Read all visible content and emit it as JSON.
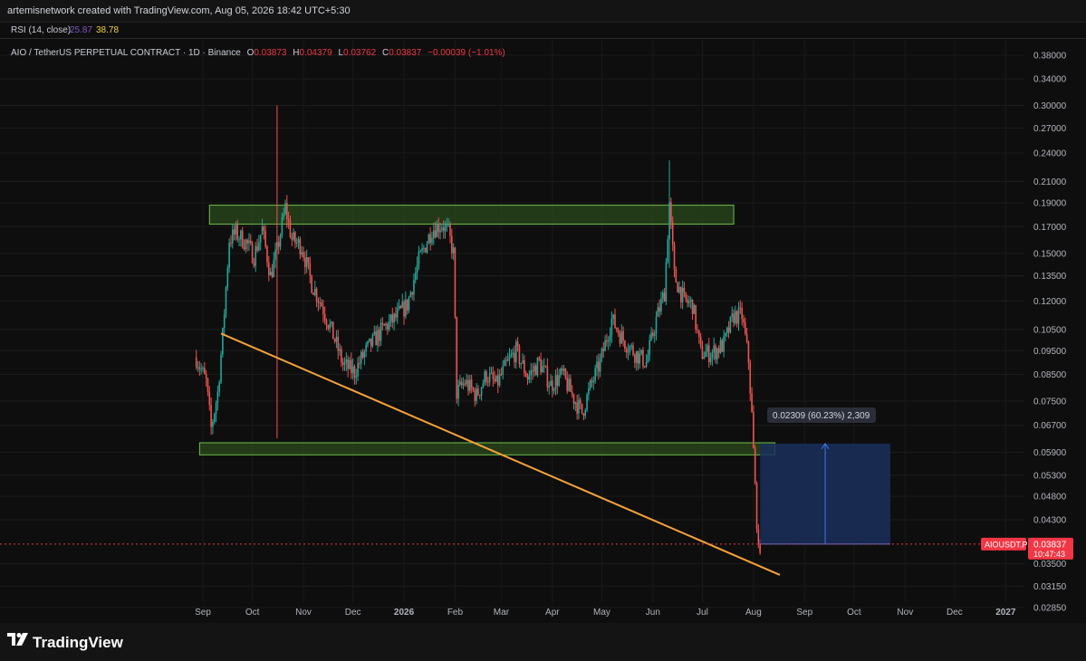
{
  "attribution": "artemisnetwork created with TradingView.com, Aug 05, 2026 18:42 UTC+5:30",
  "indicator": {
    "label": "RSI (14, close)",
    "value_1": "25.87",
    "value_2": "38.78"
  },
  "legend": {
    "symbol": "AIO / TetherUS PERPETUAL CONTRACT · 1D · Binance",
    "open_key": "O",
    "open": "0.03873",
    "high_key": "H",
    "high": "0.04379",
    "low_key": "L",
    "low": "0.03762",
    "close_key": "C",
    "close": "0.03837",
    "change": "−0.00039 (−1.01%)"
  },
  "colors": {
    "up": "#26a69a",
    "down": "#ef5350",
    "zone_fill": "#2b4a1c",
    "zone_border": "#6fbf4a",
    "trendline": "#f5a23a",
    "measure_fill": "#1a2f5c",
    "measure_line": "#3d7be8",
    "price_tag": "#f23645",
    "background": "#0e0e0e"
  },
  "price_axis": {
    "ticks": [
      "0.38000",
      "0.34000",
      "0.30000",
      "0.27000",
      "0.24000",
      "0.21000",
      "0.19000",
      "0.17000",
      "0.15000",
      "0.13500",
      "0.12000",
      "0.10500",
      "0.09500",
      "0.08500",
      "0.07500",
      "0.06700",
      "0.05900",
      "0.05300",
      "0.04800",
      "0.04300",
      "0.03500",
      "0.03150",
      "0.02850"
    ],
    "log_scale": true
  },
  "time_axis": {
    "labels": [
      "Sep",
      "Oct",
      "Nov",
      "Dec",
      "2026",
      "Feb",
      "Mar",
      "Apr",
      "May",
      "Jun",
      "Jul",
      "Aug",
      "Sep",
      "Oct",
      "Nov",
      "Dec",
      "2027"
    ],
    "bold": [
      "2026",
      "2027"
    ]
  },
  "last_price": {
    "symbol_tag": "AIOUSDT.P",
    "price": "0.03837",
    "countdown": "10:47:43",
    "value": 0.03837
  },
  "measure": {
    "label": "0.02309 (60.23%) 2,309",
    "from": 0.03837,
    "to": 0.06146
  },
  "zones": [
    {
      "name": "resistance",
      "low": 0.172,
      "high": 0.188
    },
    {
      "name": "support",
      "low": 0.0583,
      "high": 0.0617
    }
  ],
  "trendline": {
    "from_price": 0.103,
    "to_price": 0.0332
  },
  "brand": {
    "name": "TradingView"
  },
  "chart_data": {
    "type": "candlestick",
    "title": "AIO / TetherUS PERPETUAL CONTRACT · 1D · Binance",
    "yscale": "log",
    "ylim": [
      0.0265,
      0.41
    ],
    "price_anchors": [
      [
        "2025-08-28",
        0.092
      ],
      [
        "2025-09-03",
        0.082
      ],
      [
        "2025-09-06",
        0.066
      ],
      [
        "2025-09-10",
        0.078
      ],
      [
        "2025-09-13",
        0.102
      ],
      [
        "2025-09-17",
        0.16
      ],
      [
        "2025-09-21",
        0.165
      ],
      [
        "2025-09-27",
        0.158
      ],
      [
        "2025-10-02",
        0.148
      ],
      [
        "2025-10-07",
        0.168
      ],
      [
        "2025-10-12",
        0.135
      ],
      [
        "2025-10-16",
        0.152
      ],
      [
        "2025-10-21",
        0.186
      ],
      [
        "2025-10-25",
        0.16
      ],
      [
        "2025-10-31",
        0.155
      ],
      [
        "2025-11-06",
        0.13
      ],
      [
        "2025-11-12",
        0.118
      ],
      [
        "2025-11-20",
        0.1
      ],
      [
        "2025-11-25",
        0.089
      ],
      [
        "2025-12-02",
        0.086
      ],
      [
        "2025-12-08",
        0.094
      ],
      [
        "2025-12-14",
        0.1
      ],
      [
        "2025-12-20",
        0.106
      ],
      [
        "2025-12-26",
        0.11
      ],
      [
        "2026-01-03",
        0.118
      ],
      [
        "2026-01-10",
        0.145
      ],
      [
        "2026-01-18",
        0.168
      ],
      [
        "2026-01-24",
        0.172
      ],
      [
        "2026-01-28",
        0.165
      ],
      [
        "2026-01-31",
        0.15
      ],
      [
        "2026-02-02",
        0.078
      ],
      [
        "2026-02-07",
        0.082
      ],
      [
        "2026-02-14",
        0.077
      ],
      [
        "2026-02-20",
        0.085
      ],
      [
        "2026-02-26",
        0.081
      ],
      [
        "2026-03-05",
        0.09
      ],
      [
        "2026-03-10",
        0.095
      ],
      [
        "2026-03-17",
        0.084
      ],
      [
        "2026-03-24",
        0.09
      ],
      [
        "2026-03-31",
        0.081
      ],
      [
        "2026-04-07",
        0.085
      ],
      [
        "2026-04-14",
        0.076
      ],
      [
        "2026-04-19",
        0.071
      ],
      [
        "2026-04-24",
        0.08
      ],
      [
        "2026-04-30",
        0.09
      ],
      [
        "2026-05-07",
        0.11
      ],
      [
        "2026-05-14",
        0.1
      ],
      [
        "2026-05-21",
        0.094
      ],
      [
        "2026-05-28",
        0.09
      ],
      [
        "2026-06-03",
        0.11
      ],
      [
        "2026-06-08",
        0.125
      ],
      [
        "2026-06-11",
        0.19
      ],
      [
        "2026-06-14",
        0.135
      ],
      [
        "2026-06-20",
        0.12
      ],
      [
        "2026-06-25",
        0.118
      ],
      [
        "2026-06-30",
        0.094
      ],
      [
        "2026-07-07",
        0.094
      ],
      [
        "2026-07-14",
        0.098
      ],
      [
        "2026-07-20",
        0.112
      ],
      [
        "2026-07-25",
        0.112
      ],
      [
        "2026-07-29",
        0.091
      ],
      [
        "2026-07-31",
        0.07
      ],
      [
        "2026-08-02",
        0.05
      ],
      [
        "2026-08-04",
        0.037
      ],
      [
        "2026-08-05",
        0.03837
      ]
    ],
    "wick_spikes": [
      {
        "date": "2025-10-16",
        "high": 0.3,
        "low": 0.063
      },
      {
        "date": "2026-06-11",
        "high": 0.232,
        "low": 0.14
      }
    ]
  }
}
